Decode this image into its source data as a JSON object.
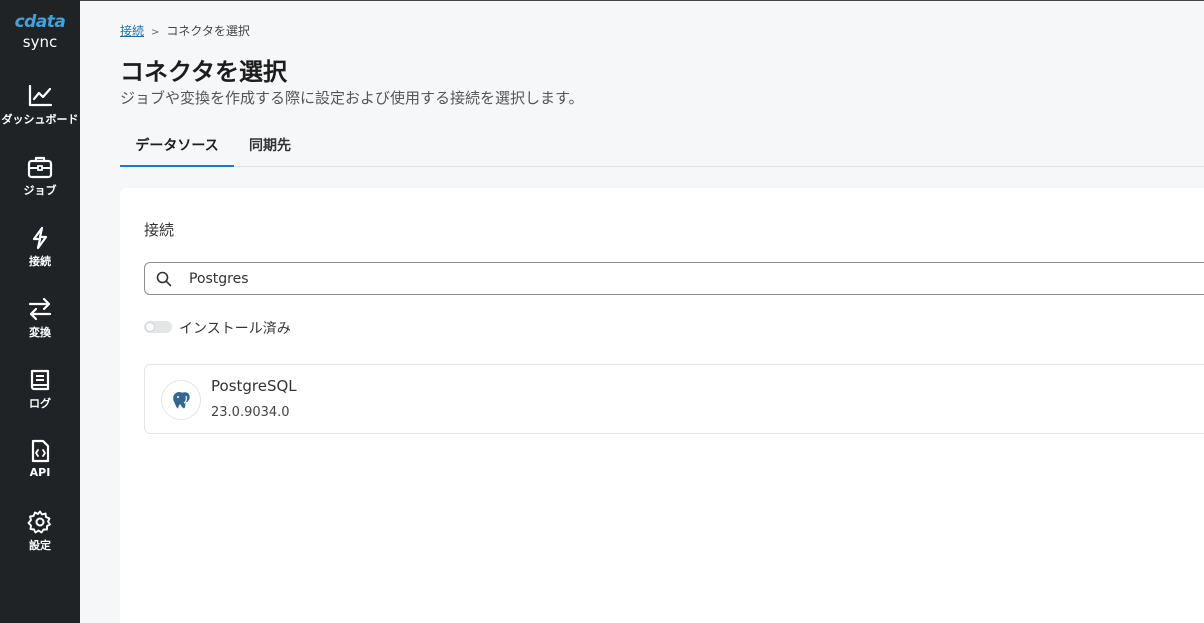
{
  "app": {
    "logo_text": "cdata",
    "logo_sub": "sync"
  },
  "sidebar": {
    "items": [
      {
        "label": "ダッシュボード",
        "icon": "chart-line-icon"
      },
      {
        "label": "ジョブ",
        "icon": "briefcase-icon"
      },
      {
        "label": "接続",
        "icon": "lightning-icon"
      },
      {
        "label": "変換",
        "icon": "swap-arrows-icon"
      },
      {
        "label": "ログ",
        "icon": "book-icon"
      },
      {
        "label": "API",
        "icon": "code-file-icon"
      },
      {
        "label": "設定",
        "icon": "gear-icon"
      }
    ]
  },
  "breadcrumb": {
    "parent": "接続",
    "separator": ">",
    "current": "コネクタを選択"
  },
  "page": {
    "title": "コネクタを選択",
    "subtitle": "ジョブや変換を作成する際に設定および使用する接続を選択します。"
  },
  "tabs": [
    {
      "label": "データソース",
      "active": true
    },
    {
      "label": "同期先",
      "active": false
    }
  ],
  "content": {
    "section_label": "接続",
    "search": {
      "value": "Postgres",
      "icon": "search-icon"
    },
    "installed_toggle": {
      "label": "インストール済み",
      "on": false
    },
    "connectors": [
      {
        "name": "PostgreSQL",
        "version": "23.0.9034.0",
        "icon": "postgresql-elephant-icon"
      }
    ]
  },
  "colors": {
    "sidebar_bg": "#1f2326",
    "accent": "#1f78c1",
    "logo": "#3fa3df",
    "page_bg": "#f6f7f8"
  }
}
